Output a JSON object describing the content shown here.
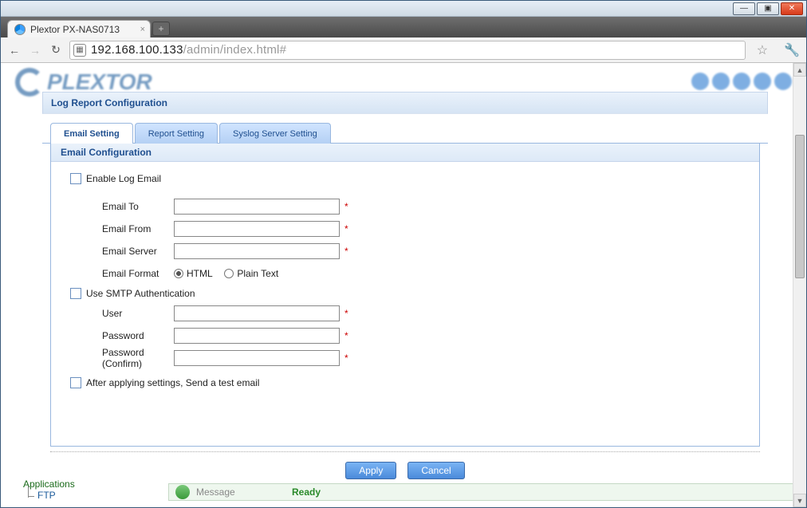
{
  "window": {
    "tab_title": "Plextor PX-NAS0713",
    "url_host": "192.168.100.133",
    "url_path": "/admin/index.html#"
  },
  "brand": "PLEXTOR",
  "panel": {
    "title": "Log Report Configuration",
    "tabs": [
      {
        "label": "Email Setting"
      },
      {
        "label": "Report Setting"
      },
      {
        "label": "Syslog Server Setting"
      }
    ],
    "section_header": "Email Configuration",
    "enable_label": "Enable Log Email",
    "fields": {
      "email_to_label": "Email To",
      "email_from_label": "Email From",
      "email_server_label": "Email Server",
      "email_format_label": "Email Format",
      "format_html": "HTML",
      "format_plain": "Plain Text",
      "smtp_auth_label": "Use SMTP Authentication",
      "user_label": "User",
      "password_label": "Password",
      "password_confirm_label": "Password (Confirm)",
      "test_label": "After applying settings, Send a test email"
    },
    "values": {
      "email_to": "",
      "email_from": "",
      "email_server": "",
      "user": "",
      "password": "",
      "password_confirm": ""
    },
    "buttons": {
      "apply": "Apply",
      "cancel": "Cancel"
    }
  },
  "sidebar": {
    "applications": "Applications",
    "ftp": "FTP"
  },
  "status": {
    "label": "Message",
    "value": "Ready"
  }
}
